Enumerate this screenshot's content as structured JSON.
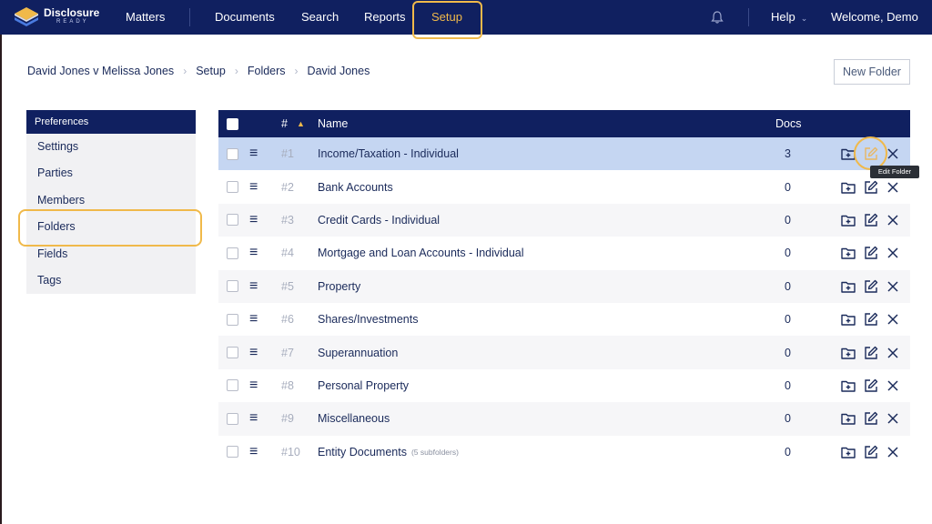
{
  "brand": {
    "name": "Disclosure",
    "tagline": "READY"
  },
  "nav": {
    "matters": "Matters",
    "documents": "Documents",
    "search": "Search",
    "reports": "Reports",
    "setup": "Setup",
    "help": "Help",
    "welcome": "Welcome, Demo"
  },
  "breadcrumb": [
    "David Jones v Melissa Jones",
    "Setup",
    "Folders",
    "David Jones"
  ],
  "new_folder_label": "New Folder",
  "sidebar": {
    "heading": "Preferences",
    "items": [
      "Settings",
      "Parties",
      "Members",
      "Folders",
      "Fields",
      "Tags"
    ],
    "active": "Folders"
  },
  "table": {
    "headers": {
      "hash": "#",
      "name": "Name",
      "docs": "Docs"
    },
    "rows": [
      {
        "num": "#1",
        "name": "Income/Taxation - Individual",
        "docs": "3",
        "sub": ""
      },
      {
        "num": "#2",
        "name": "Bank Accounts",
        "docs": "0",
        "sub": ""
      },
      {
        "num": "#3",
        "name": "Credit Cards - Individual",
        "docs": "0",
        "sub": ""
      },
      {
        "num": "#4",
        "name": "Mortgage and Loan Accounts - Individual",
        "docs": "0",
        "sub": ""
      },
      {
        "num": "#5",
        "name": "Property",
        "docs": "0",
        "sub": ""
      },
      {
        "num": "#6",
        "name": "Shares/Investments",
        "docs": "0",
        "sub": ""
      },
      {
        "num": "#7",
        "name": "Superannuation",
        "docs": "0",
        "sub": ""
      },
      {
        "num": "#8",
        "name": "Personal Property",
        "docs": "0",
        "sub": ""
      },
      {
        "num": "#9",
        "name": "Miscellaneous",
        "docs": "0",
        "sub": ""
      },
      {
        "num": "#10",
        "name": "Entity Documents",
        "docs": "0",
        "sub": "(5 subfolders)"
      }
    ]
  },
  "tooltip": "Edit Folder",
  "colors": {
    "navy": "#102060",
    "highlight": "#f0b94a",
    "selected_row": "#c5d6f2"
  }
}
